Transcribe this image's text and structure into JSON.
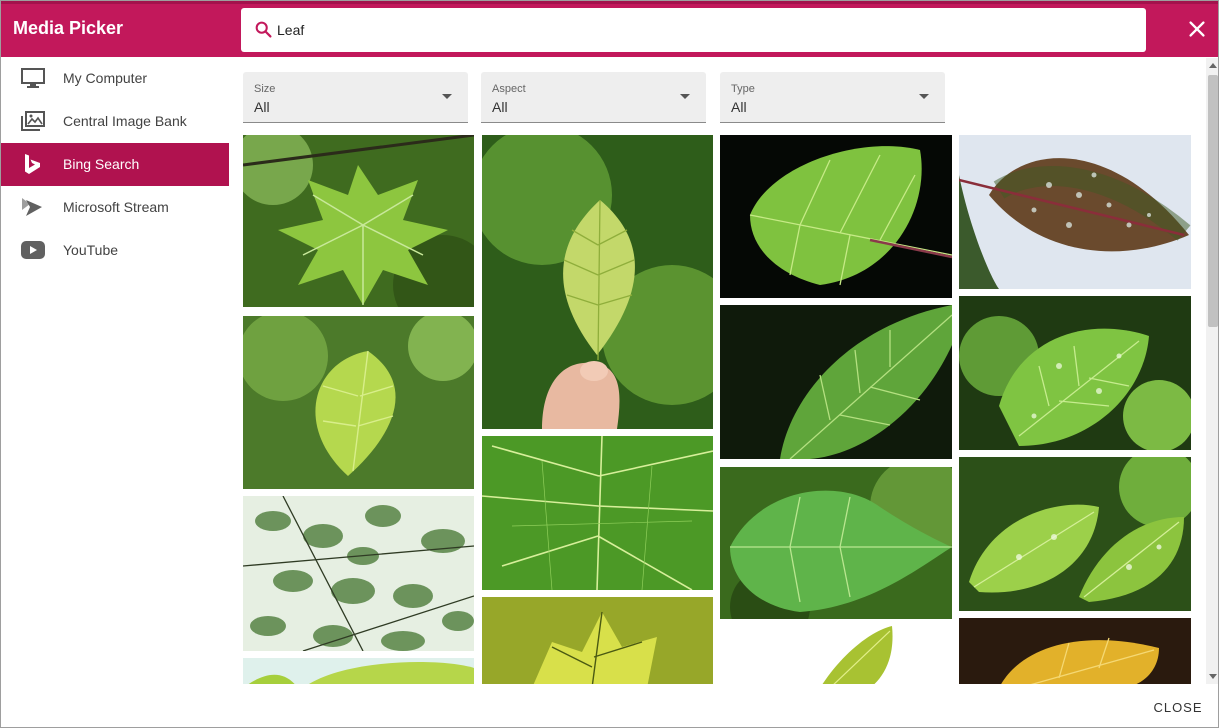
{
  "header": {
    "title": "Media Picker",
    "accent_color": "#c2185b",
    "search_value": "Leaf",
    "search_icon": "search-icon",
    "close_icon": "close-icon"
  },
  "sidebar": {
    "items": [
      {
        "label": "My Computer",
        "icon": "monitor-icon",
        "active": false
      },
      {
        "label": "Central Image Bank",
        "icon": "image-library-icon",
        "active": false
      },
      {
        "label": "Bing Search",
        "icon": "bing-icon",
        "active": true
      },
      {
        "label": "Microsoft Stream",
        "icon": "stream-icon",
        "active": false
      },
      {
        "label": "YouTube",
        "icon": "youtube-icon",
        "active": false
      }
    ]
  },
  "filters": [
    {
      "label": "Size",
      "value": "All"
    },
    {
      "label": "Aspect",
      "value": "All"
    },
    {
      "label": "Type",
      "value": "All"
    }
  ],
  "results": {
    "thumbnail_count_visible": 15
  },
  "footer": {
    "close_label": "CLOSE"
  }
}
